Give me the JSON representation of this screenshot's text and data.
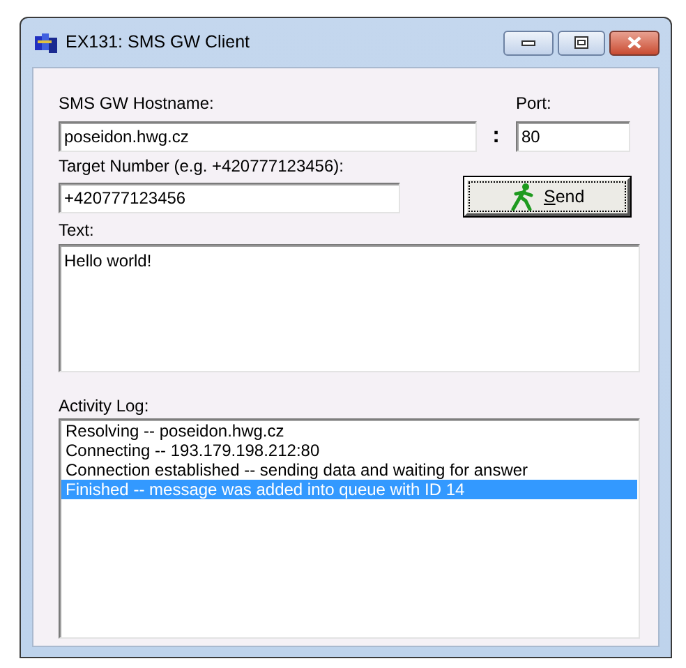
{
  "window": {
    "title": "EX131: SMS GW Client"
  },
  "hostname": {
    "label": "SMS GW Hostname:",
    "value": "poseidon.hwg.cz"
  },
  "separator": ":",
  "port": {
    "label": "Port:",
    "value": "80"
  },
  "target": {
    "label": "Target Number (e.g. +420777123456):",
    "value": "+420777123456"
  },
  "send_button": {
    "label": "Send",
    "focused": true
  },
  "text": {
    "label": "Text:",
    "value": "Hello world!"
  },
  "activity_log": {
    "label": "Activity Log:",
    "items": [
      {
        "text": "Resolving -- poseidon.hwg.cz",
        "selected": false
      },
      {
        "text": "Connecting -- 193.179.198.212:80",
        "selected": false
      },
      {
        "text": "Connection established -- sending data and waiting for answer",
        "selected": false
      },
      {
        "text": "Finished -- message was added into queue with ID 14",
        "selected": true
      }
    ]
  }
}
